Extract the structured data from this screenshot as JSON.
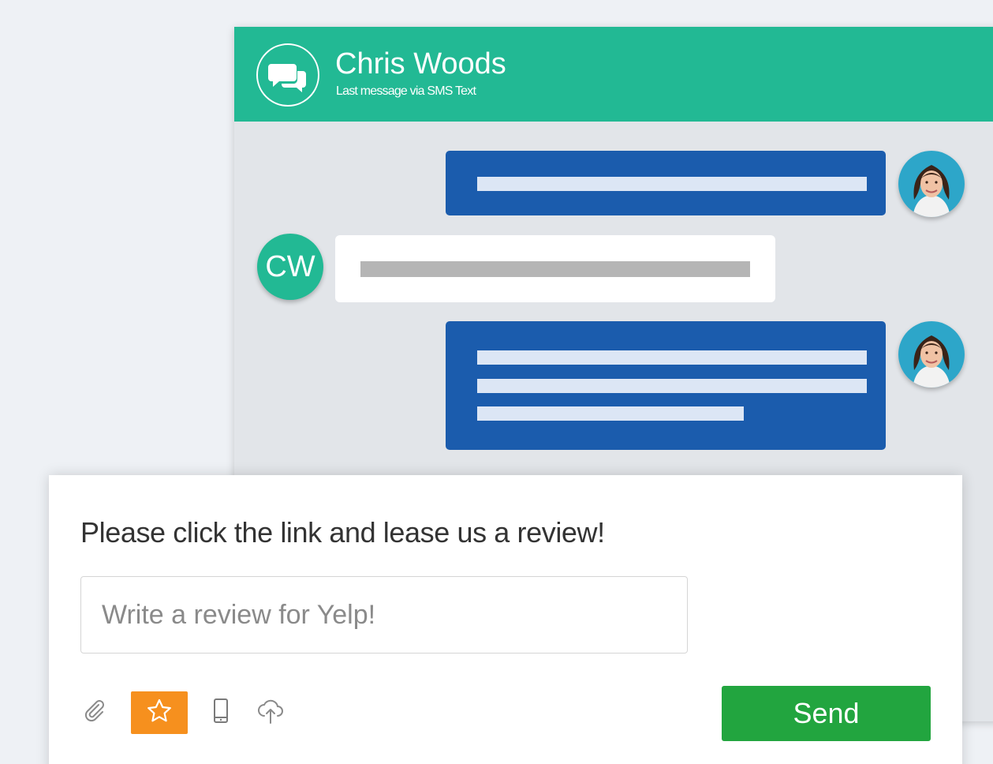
{
  "header": {
    "name": "Chris Woods",
    "subtitle": "Last message via SMS Text",
    "icon": "chat-bubbles-icon"
  },
  "contact_avatar": {
    "initials": "CW"
  },
  "review": {
    "prompt": "Please click the link and lease us a review!",
    "placeholder": "Write a review for Yelp!",
    "send_label": "Send"
  },
  "toolbar": {
    "icons": [
      "paperclip-icon",
      "star-icon",
      "mobile-phone-icon",
      "cloud-upload-icon"
    ],
    "active": "star-icon"
  },
  "colors": {
    "header": "#22b994",
    "outgoing_bubble": "#1b5cad",
    "incoming_bubble": "#ffffff",
    "active_tool": "#f6901e",
    "send_button": "#22a53f",
    "background": "#eef1f5"
  }
}
